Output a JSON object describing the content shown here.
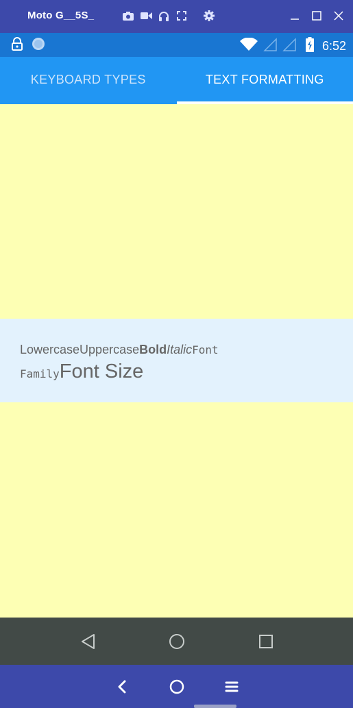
{
  "emulator": {
    "device_title": "Moto G__5S_",
    "tools": [
      "camera-icon",
      "video-icon",
      "headphones-icon",
      "fullscreen-icon",
      "settings-icon"
    ],
    "window_controls": [
      "minimize-icon",
      "maximize-icon",
      "close-icon"
    ]
  },
  "status_bar": {
    "time": "6:52",
    "left_icons": [
      "lock-icon",
      "sync-icon"
    ],
    "right_icons": [
      "wifi-icon",
      "signal-icon",
      "signal-icon",
      "battery-charging-icon"
    ]
  },
  "tabs": [
    {
      "label": "KEYBOARD TYPES",
      "active": false
    },
    {
      "label": "TEXT FORMATTING",
      "active": true
    }
  ],
  "formatted_text": {
    "lowercase": "Lowercase",
    "uppercase": "Uppercase",
    "bold": "Bold",
    "italic": "Italic",
    "font_family_1": "Font",
    "font_family_2": "Family",
    "font_size": "Font Size"
  },
  "android_nav": [
    "back-icon",
    "home-icon",
    "recents-icon"
  ],
  "emulator_nav": [
    "back-chevron-icon",
    "home-circle-icon",
    "menu-icon"
  ],
  "colors": {
    "emulator_bar": "#3d49aa",
    "status_bar": "#1976d2",
    "tab_bar": "#2196f3",
    "content_bg": "#fdffb4",
    "panel_bg": "#e3f2fd",
    "nav_bar": "#424a47"
  }
}
